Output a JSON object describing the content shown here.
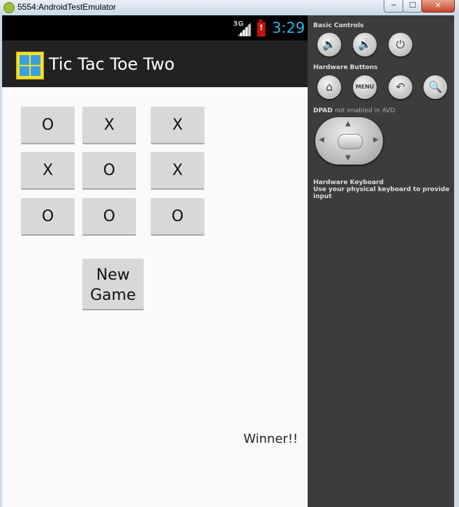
{
  "window": {
    "title": "5554:AndroidTestEmulator",
    "minimize_glyph": "─",
    "maximize_glyph": "☐",
    "close_glyph": "✕"
  },
  "status_bar": {
    "network": "3G",
    "battery_glyph": "!",
    "time": "3:29"
  },
  "action_bar": {
    "title": "Tic Tac Toe Two"
  },
  "board": {
    "cells": [
      "O",
      "X",
      "X",
      "X",
      "O",
      "X",
      "O",
      "O",
      "O"
    ]
  },
  "new_game": {
    "line1": "New",
    "line2": "Game"
  },
  "status": {
    "winner": "Winner!!"
  },
  "panel": {
    "basic_controls": "Basic Controls",
    "hardware_buttons": "Hardware Buttons",
    "dpad_label": "DPAD",
    "dpad_note": "not enabled in AVD",
    "keyboard_title": "Hardware Keyboard",
    "keyboard_hint": "Use your physical keyboard to provide input",
    "menu_label": "MENU"
  },
  "icons": {
    "volume_down": "🔉",
    "volume_up": "🔊",
    "power": "⏻",
    "home": "⌂",
    "back": "↶",
    "search": "🔍",
    "dpad_up": "▲",
    "dpad_down": "▼",
    "dpad_left": "◀",
    "dpad_right": "▶"
  },
  "colors": {
    "clock": "#33b5e5",
    "action_bar": "#222222",
    "panel": "#3c3c3c",
    "battery": "#c0150f"
  }
}
